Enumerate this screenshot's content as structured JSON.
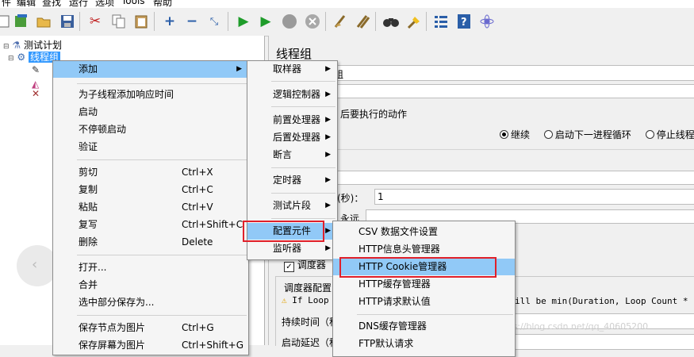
{
  "menubar": [
    "件",
    "编辑",
    "查找",
    "运行",
    "选项",
    "Tools",
    "帮助"
  ],
  "toolbar_icons": [
    "new-icon",
    "templates-icon",
    "open-icon",
    "save-icon",
    "cut-icon",
    "copy-icon",
    "paste-icon",
    "expand-icon",
    "collapse-icon",
    "toggle-icon",
    "start-icon",
    "start-no-pause-icon",
    "stop-icon",
    "shutdown-icon",
    "clear-icon",
    "clear-all-icon",
    "search-icon",
    "reset-search-icon",
    "function-helper-icon",
    "help-icon",
    "remote-icon"
  ],
  "tree": {
    "root": "测试计划",
    "thread_group": "线程组"
  },
  "right_panel": {
    "title": "线程组",
    "name_fragment": "组",
    "error_action_label": "后要执行的动作",
    "radio_continue": "继续",
    "radio_next_loop": "启动下一进程循环",
    "radio_stop_thread": "停止线程",
    "ramp_label": "(秒)：",
    "ramp_value": "1",
    "loop_fragment": "永远",
    "scheduler_checkbox": "调度器",
    "scheduler_config": "调度器配置",
    "warning_prefix": "If Loop",
    "warning_suffix": "ill be min(Duration, Loop Count * iter",
    "duration_label": "持续时间（秒",
    "startup_delay_label": "启动延迟（秒"
  },
  "context_menu": {
    "add": "添加",
    "add_think_times": "为子线程添加响应时间",
    "start": "启动",
    "start_no_pause": "不停顿启动",
    "validate": "验证",
    "cut": "剪切",
    "cut_sc": "Ctrl+X",
    "copy": "复制",
    "copy_sc": "Ctrl+C",
    "paste": "粘贴",
    "paste_sc": "Ctrl+V",
    "duplicate": "复写",
    "duplicate_sc": "Ctrl+Shift+C",
    "delete": "删除",
    "delete_sc": "Delete",
    "open": "打开...",
    "merge": "合并",
    "save_selection": "选中部分保存为...",
    "save_node_image": "保存节点为图片",
    "save_node_image_sc": "Ctrl+G",
    "save_screen_image": "保存屏幕为图片",
    "save_screen_image_sc": "Ctrl+Shift+G"
  },
  "add_submenu": {
    "sampler": "取样器",
    "logic_controller": "逻辑控制器",
    "pre_processor": "前置处理器",
    "post_processor": "后置处理器",
    "assertion": "断言",
    "timer": "定时器",
    "test_fragment": "测试片段",
    "config_element": "配置元件",
    "listener": "监听器"
  },
  "config_submenu": {
    "csv": "CSV 数据文件设置",
    "header_manager": "HTTP信息头管理器",
    "cookie_manager": "HTTP Cookie管理器",
    "cache_manager": "HTTP缓存管理器",
    "request_defaults": "HTTP请求默认值",
    "dns_cache": "DNS缓存管理器",
    "ftp_defaults": "FTP默认请求"
  },
  "colors": {
    "highlight": "#91c9f7",
    "red_box": "#e0202a",
    "tree_selection": "#3399ff"
  },
  "watermark": "https://blog.csdn.net/qq_40605200"
}
